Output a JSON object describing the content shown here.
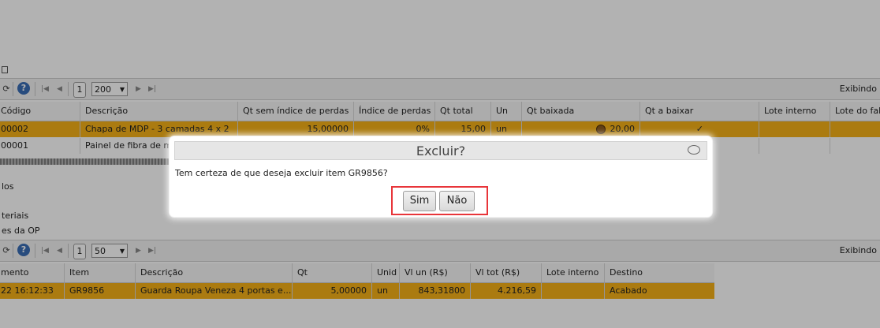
{
  "upper_toolbar": {
    "help": "?",
    "page": "1",
    "page_size": "200",
    "exibindo": "Exibindo"
  },
  "upper_table": {
    "headers": [
      "Código",
      "Descrição",
      "Qt sem índice de perdas",
      "Índice de perdas",
      "Qt total",
      "Un",
      "Qt baixada",
      "Qt a baixar",
      "Lote interno",
      "Lote do fab"
    ],
    "rows": [
      [
        "00002",
        "Chapa de MDP - 3 camadas 4 x 2",
        "15,00000",
        "0%",
        "15,00",
        "un",
        "20,00",
        "✓",
        "",
        ""
      ],
      [
        "00001",
        "Painel de fibra de m",
        "",
        "",
        "",
        "",
        "",
        "",
        "",
        ""
      ]
    ]
  },
  "side_labels": [
    "los",
    "teriais",
    "es da OP"
  ],
  "lower_toolbar": {
    "help": "?",
    "page": "1",
    "page_size": "50",
    "exibindo": "Exibindo"
  },
  "lower_table": {
    "headers": [
      "mento",
      "Item",
      "Descrição",
      "Qt",
      "Unid",
      "Vl un (R$)",
      "Vl tot (R$)",
      "Lote interno",
      "Destino"
    ],
    "rows": [
      [
        "22 16:12:33",
        "GR9856",
        "Guarda Roupa Veneza 4 portas e...",
        "5,00000",
        "un",
        "843,31800",
        "4.216,59",
        "",
        "Acabado"
      ]
    ]
  },
  "dialog": {
    "title": "Excluir?",
    "message": "Tem certeza de que deseja excluir item GR9856?",
    "yes_label": "Sim",
    "no_label": "Não"
  }
}
